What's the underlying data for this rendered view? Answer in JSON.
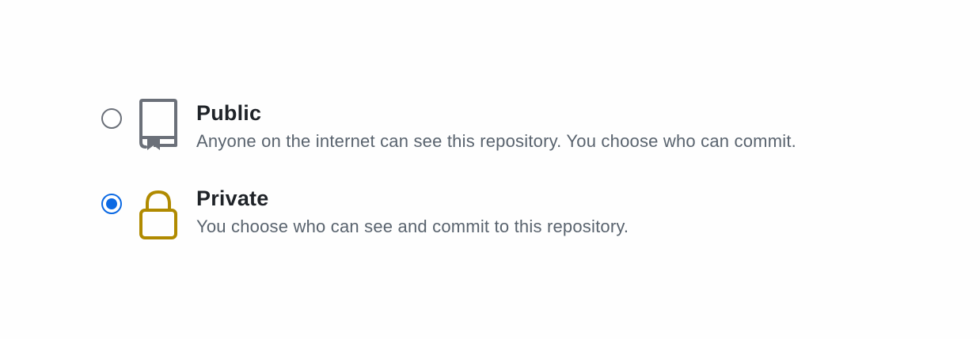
{
  "visibility_options": [
    {
      "title": "Public",
      "description": "Anyone on the internet can see this repository. You choose who can commit.",
      "icon": "repo-book-icon",
      "icon_color": "#6b7079",
      "selected": false
    },
    {
      "title": "Private",
      "description": "You choose who can see and commit to this repository.",
      "icon": "lock-icon",
      "icon_color": "#b08a00",
      "selected": true
    }
  ],
  "accent_color": "#0b69e3"
}
